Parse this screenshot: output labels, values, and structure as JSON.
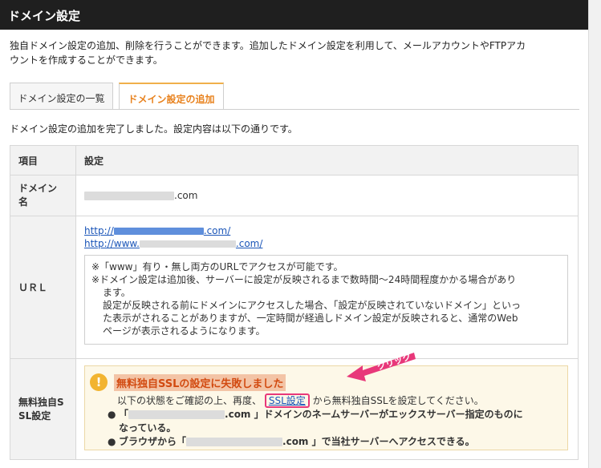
{
  "header": {
    "title": "ドメイン設定"
  },
  "intro": {
    "line1": "独自ドメイン設定の追加、削除を行うことができます。追加したドメイン設定を利用して、メールアカウントやFTPアカ",
    "line2": "ウントを作成することができます。"
  },
  "tabs": [
    {
      "label": "ドメイン設定の一覧"
    },
    {
      "label": "ドメイン設定の追加"
    }
  ],
  "done_message": "ドメイン設定の追加を完了しました。設定内容は以下の通りです。",
  "table": {
    "head": {
      "item": "項目",
      "setting": "設定"
    },
    "domain": {
      "label_l1": "ドメイン",
      "label_l2": "名",
      "suffix": ".com"
    },
    "url": {
      "label": "ＵＲＬ",
      "link1_prefix": "http://",
      "link1_suffix": ".com/",
      "link2_prefix": "http://www.",
      "link2_suffix": ".com/",
      "note1": "※「www」有り・無し両方のURLでアクセスが可能です。",
      "note2": "※ドメイン設定は追加後、サーバーに設定が反映されるまで数時間〜24時間程度かかる場合があり",
      "note3": "ます。",
      "note4": "設定が反映される前にドメインにアクセスした場合、「設定が反映されていないドメイン」といっ",
      "note5": "た表示がされることがありますが、一定時間が経過しドメイン設定が反映されると、通常のWeb",
      "note6": "ページが表示されるようになります。"
    },
    "ssl": {
      "label_l1": "無料独自S",
      "label_l2": "SL設定",
      "warn_title": "無料独自SSLの設定に失敗しました",
      "text_before": "以下の状態をご確認の上、再度、",
      "link": "SSL設定",
      "text_after": "から無料独自SSLを設定してください。",
      "bullet1_open": "「",
      "bullet1_rest": ".com 」ドメインのネームサーバーがエックスサーバー指定のものに",
      "bullet1_cont": "なっている。",
      "bullet2_open": "ブラウザから「",
      "bullet2_rest": ".com 」で当社サーバーへアクセスできる。"
    }
  },
  "annotation": {
    "label": "クリック"
  },
  "colors": {
    "accent": "#e8821e",
    "pink": "#e8387a",
    "link": "#1a55b8"
  }
}
